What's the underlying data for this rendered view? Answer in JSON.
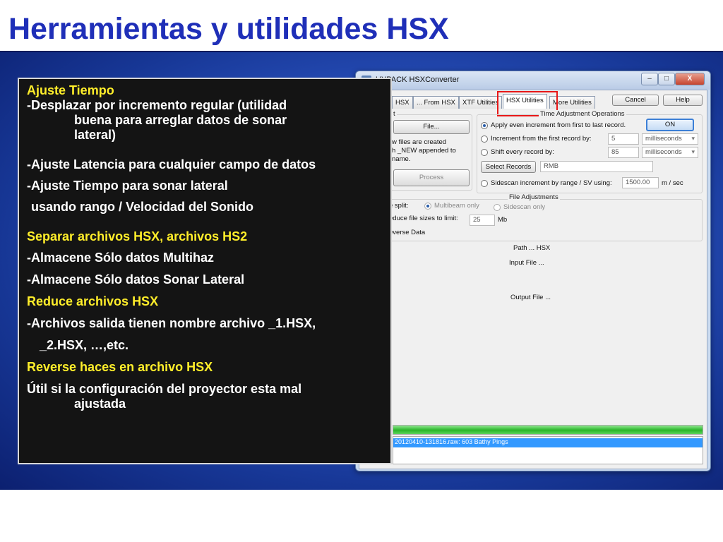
{
  "slide": {
    "title": "Herramientas y utilidades HSX"
  },
  "app": {
    "window_title": "HYPACK HSXConverter",
    "titlebar_buttons": {
      "minimize": "–",
      "maximize": "□",
      "close": "X"
    },
    "tabs": [
      {
        "label": "HSX"
      },
      {
        "label": "... From HSX"
      },
      {
        "label": "XTF Utilities"
      },
      {
        "label": "HSX Utilities"
      },
      {
        "label": "More Utilities"
      }
    ],
    "buttons": {
      "cancel": "Cancel",
      "help": "Help",
      "file": "File...",
      "process": "Process",
      "on": "ON",
      "select_records": "Select Records"
    },
    "left_panel": {
      "group_label": "t",
      "info_line1": "w files are created",
      "info_line2": "h _NEW appended to",
      "info_line3": "name."
    },
    "time_adjust": {
      "group_title": "Time Adjustment Operations",
      "options": [
        {
          "label": "Apply even increment from first to last record.",
          "checked": true
        },
        {
          "label": "Increment from the first record by:",
          "checked": false
        },
        {
          "label": "Shift every record by:",
          "checked": false
        },
        {
          "label": "Sidescan increment by range / SV using:",
          "checked": false
        }
      ],
      "increment_value": "5",
      "shift_value": "85",
      "increment_unit": "milliseconds",
      "shift_unit": "milliseconds",
      "select_records_value": "RMB",
      "sv_value": "1500.00",
      "sv_unit": "m / sec"
    },
    "file_adjust": {
      "group_title": "File Adjustments",
      "split_label": "e split:",
      "split_options": [
        {
          "label": "Multibeam only",
          "checked": true
        },
        {
          "label": "Sidescan only",
          "checked": false
        }
      ],
      "reduce_label": "educe file sizes to limit:",
      "reduce_value": "25",
      "reduce_unit": "Mb",
      "reverse_label": "everse Data"
    },
    "paths": {
      "path_label": "Path ... HSX",
      "input_label": "Input File ...",
      "output_label": "Output File ..."
    },
    "progress": {
      "fraction": 1.0
    },
    "log": {
      "line": "20120410-131816.raw: 603 Bathy Pings"
    }
  },
  "panel": {
    "lines": [
      {
        "text": "Ajuste Tiempo",
        "style": "yellow"
      },
      {
        "text": "-Desplazar por incremento regular (utilidad",
        "style": "white"
      },
      {
        "text": "buena para arreglar datos de sonar",
        "style": "white-indent"
      },
      {
        "text": "lateral)",
        "style": "white-indent"
      },
      {
        "text": "-Ajuste Latencia para cualquier campo de datos",
        "style": "white"
      },
      {
        "text": "-Ajuste Tiempo para sonar lateral",
        "style": "white"
      },
      {
        "text": "usando rango / Velocidad del Sonido",
        "style": "white-indent-sm"
      },
      {
        "text": "Separar archivos HSX, archivos HS2",
        "style": "yellow"
      },
      {
        "text": "-Almacene Sólo datos Multihaz",
        "style": "white"
      },
      {
        "text": "-Almacene Sólo datos Sonar Lateral",
        "style": "white"
      },
      {
        "text": "Reduce archivos HSX",
        "style": "yellow"
      },
      {
        "text": "-Archivos salida tienen nombre archivo _1.HSX,",
        "style": "white"
      },
      {
        "text": "_2.HSX, …,etc.",
        "style": "white-indent-xs"
      },
      {
        "text": "Reverse haces en archivo HSX",
        "style": "yellow"
      },
      {
        "text": "Útil si la configuración del proyector  esta mal",
        "style": "white"
      },
      {
        "text": "ajustada",
        "style": "white-indent"
      }
    ]
  }
}
